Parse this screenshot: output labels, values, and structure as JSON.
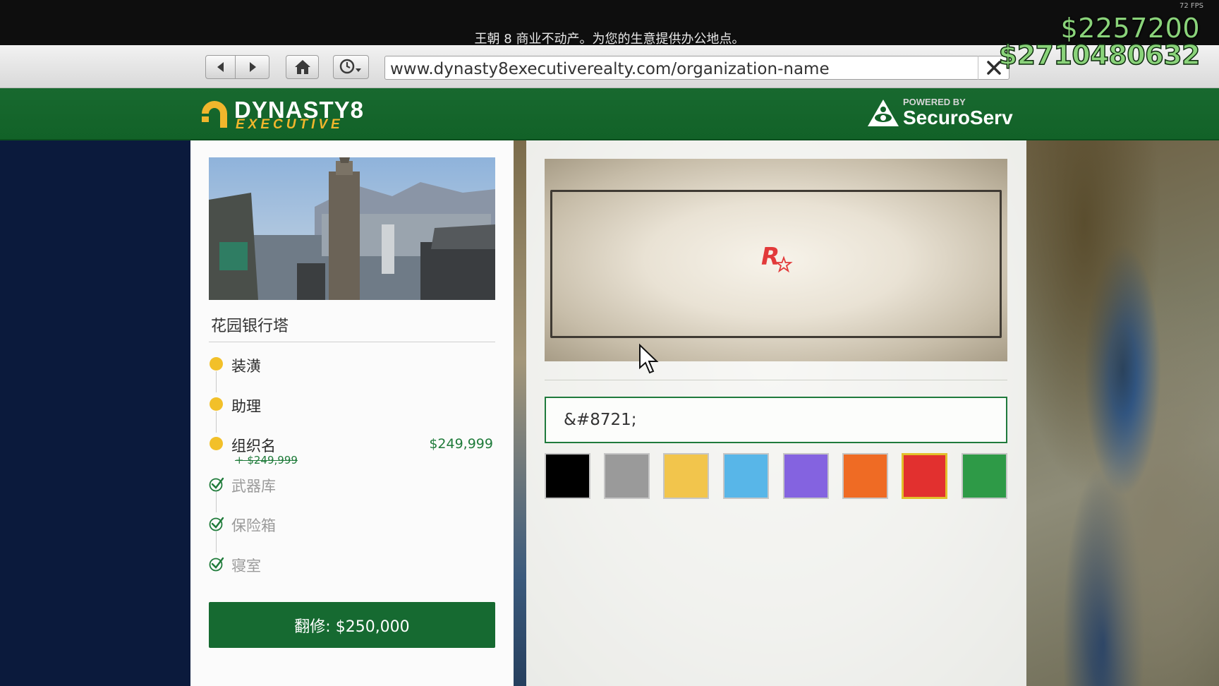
{
  "hud": {
    "fps": "72 FPS",
    "money_cash": "$2257200",
    "money_bank": "$2710480632"
  },
  "browser": {
    "tagline": "王朝 8 商业不动产。为您的生意提供办公地点。",
    "url": "www.dynasty8executiverealty.com/organization-name",
    "back_icon": "back-arrow-icon",
    "forward_icon": "forward-arrow-icon",
    "home_icon": "home-icon",
    "history_icon": "clock-icon",
    "close_icon": "close-icon"
  },
  "site_header": {
    "logo_main": "DYNASTY8",
    "logo_sub": "EXECUTIVE",
    "powered_by": "POWERED BY",
    "partner": "SecuroServ"
  },
  "left_panel": {
    "property_name": "花园银行塔",
    "steps": [
      {
        "label": "装潢",
        "state": "current"
      },
      {
        "label": "助理",
        "state": "current"
      },
      {
        "label": "组织名",
        "state": "current",
        "price": "$249,999",
        "sub_price": "+ $249,999"
      },
      {
        "label": "武器库",
        "state": "done"
      },
      {
        "label": "保险箱",
        "state": "done"
      },
      {
        "label": "寝室",
        "state": "done"
      }
    ],
    "renovate_label": "翻修: $250,000"
  },
  "right_panel": {
    "name_input_value": "&#8721;",
    "colors": [
      "#000000",
      "#9a9a9a",
      "#f2c54c",
      "#58b6e8",
      "#8463e0",
      "#ef6b24",
      "#e2302f",
      "#2e9a47"
    ],
    "selected_color_index": 6
  },
  "colors": {
    "header_green": "#166a31",
    "accent_yellow": "#f2c029",
    "money_green": "#8ad37a"
  }
}
